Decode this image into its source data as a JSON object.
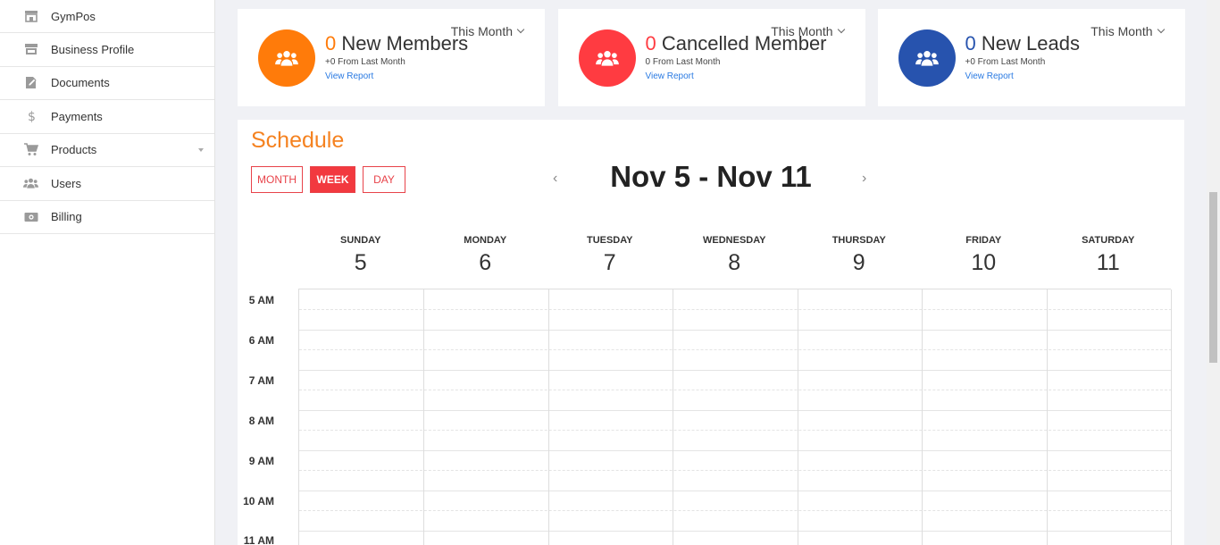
{
  "sidebar": {
    "items": [
      {
        "label": "GymPos",
        "icon": "store-icon"
      },
      {
        "label": "Business Profile",
        "icon": "storefront-icon"
      },
      {
        "label": "Documents",
        "icon": "document-icon"
      },
      {
        "label": "Payments",
        "icon": "dollar-icon"
      },
      {
        "label": "Products",
        "icon": "cart-icon",
        "has_submenu": true
      },
      {
        "label": "Users",
        "icon": "users-icon"
      },
      {
        "label": "Billing",
        "icon": "billing-icon"
      }
    ]
  },
  "cards": [
    {
      "period": "This Month",
      "count": "0",
      "title": "New Members",
      "sub": "+0 From Last Month",
      "link": "View Report",
      "color": "#ff7b0a"
    },
    {
      "period": "This Month",
      "count": "0",
      "title": "Cancelled Member",
      "sub": "0 From Last Month",
      "link": "View Report",
      "color": "#ff3b41"
    },
    {
      "period": "This Month",
      "count": "0",
      "title": "New Leads",
      "sub": "+0 From Last Month",
      "link": "View Report",
      "color": "#2753ae"
    }
  ],
  "schedule": {
    "title": "Schedule",
    "views": {
      "month": "MONTH",
      "week": "WEEK",
      "day": "DAY",
      "active": "week"
    },
    "range": "Nov 5 - Nov 11",
    "prev_glyph": "‹",
    "next_glyph": "›",
    "days": [
      {
        "name": "SUNDAY",
        "num": "5"
      },
      {
        "name": "MONDAY",
        "num": "6"
      },
      {
        "name": "TUESDAY",
        "num": "7"
      },
      {
        "name": "WEDNESDAY",
        "num": "8"
      },
      {
        "name": "THURSDAY",
        "num": "9"
      },
      {
        "name": "FRIDAY",
        "num": "10"
      },
      {
        "name": "SATURDAY",
        "num": "11"
      }
    ],
    "times": [
      "5 AM",
      "6 AM",
      "7 AM",
      "8 AM",
      "9 AM",
      "10 AM",
      "11 AM"
    ]
  },
  "colors": {
    "accent_orange": "#f58220",
    "accent_red": "#f2393f",
    "link_blue": "#2a7ae2"
  }
}
